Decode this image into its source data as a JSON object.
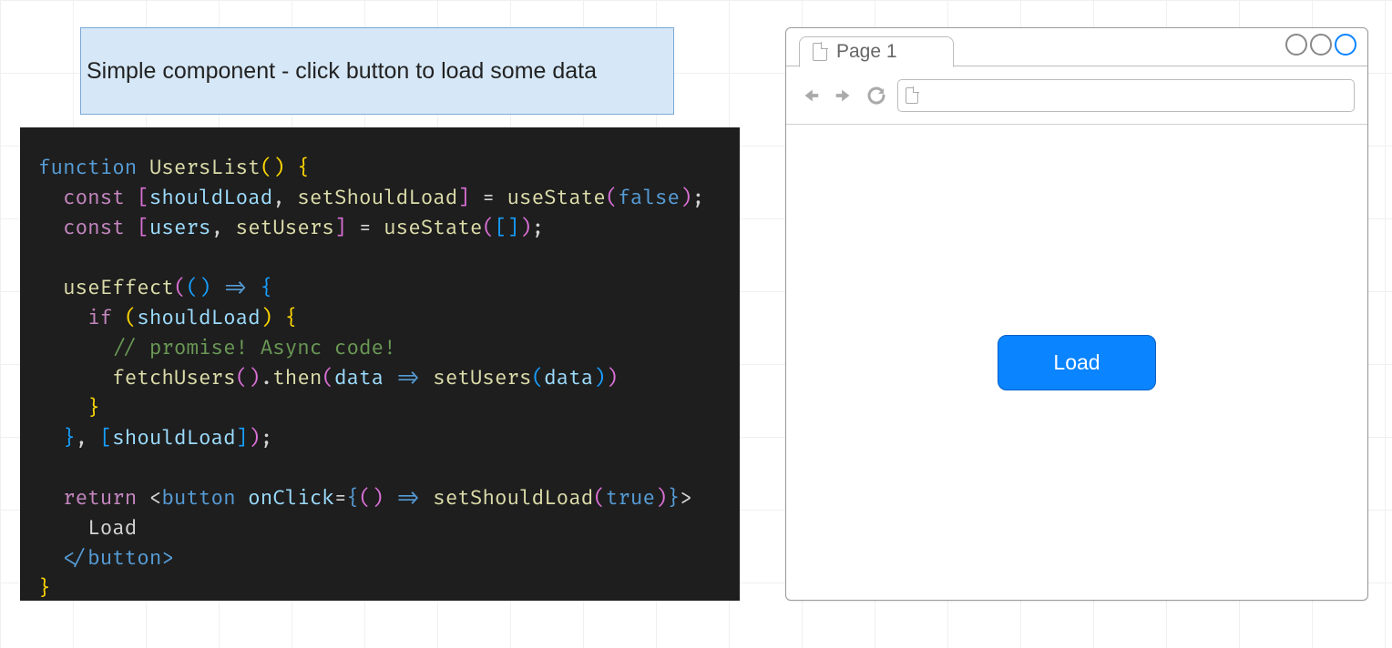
{
  "title": "Simple component - click button to load some data",
  "code": {
    "fn_keyword": "function",
    "fn_name": "UsersList",
    "const_kw": "const",
    "shouldLoad": "shouldLoad",
    "setShouldLoad": "setShouldLoad",
    "users": "users",
    "setUsers": "setUsers",
    "useState": "useState",
    "false": "false",
    "emptyArr": "[]",
    "useEffect": "useEffect",
    "if_kw": "if",
    "comment": "// promise! Async code!",
    "fetchUsers": "fetchUsers",
    "then": "then",
    "data": "data",
    "return_kw": "return",
    "button_tag": "button",
    "onClick_attr": "onClick",
    "true": "true",
    "load_text": "Load",
    "close_button": "</button>"
  },
  "browser": {
    "tab_label": "Page 1",
    "address_value": "",
    "load_button_label": "Load"
  }
}
